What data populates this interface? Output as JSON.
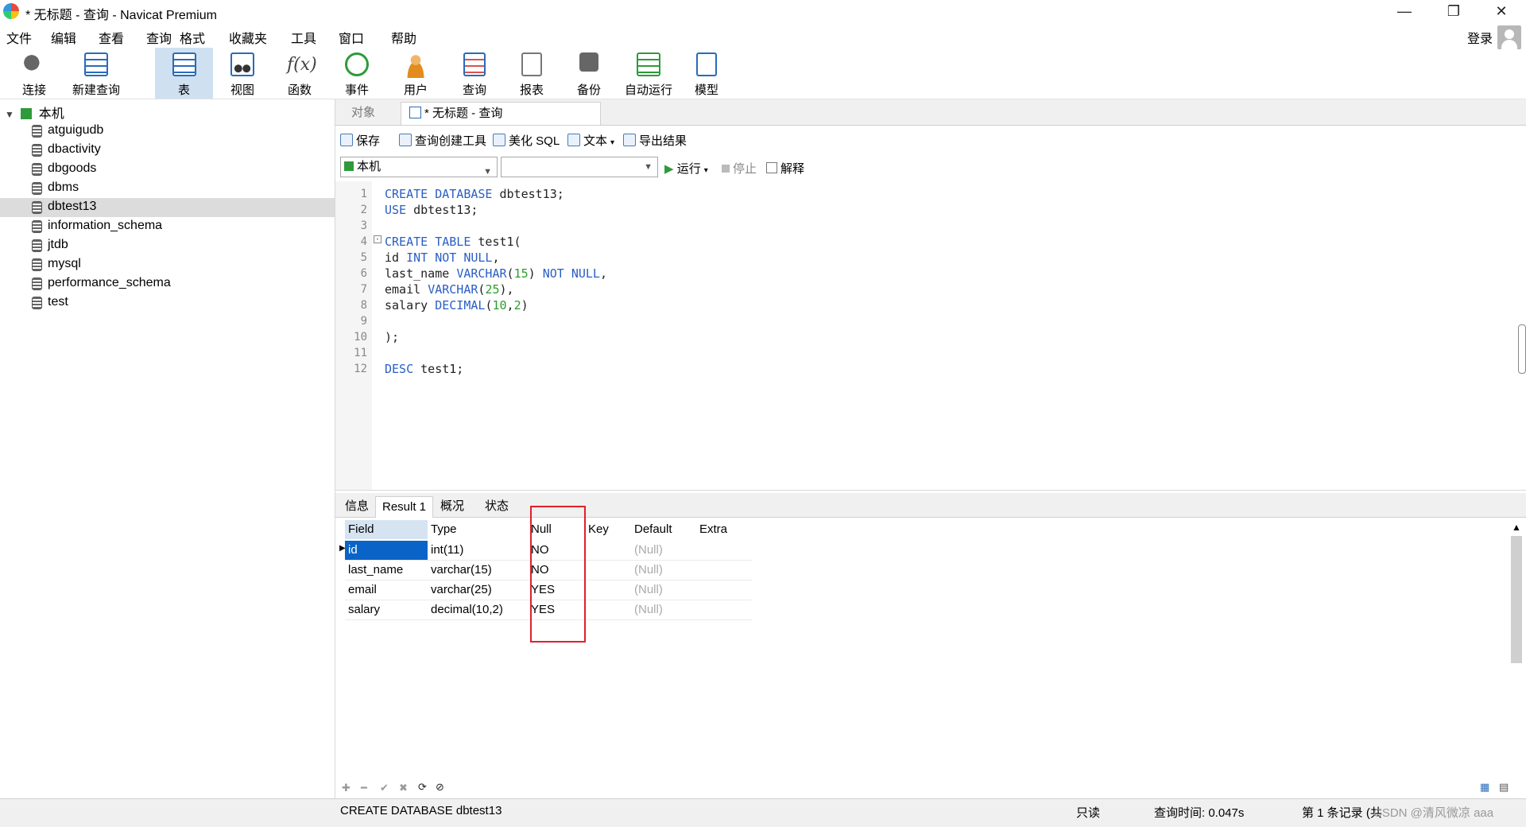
{
  "window": {
    "title": "* 无标题 - 查询 - Navicat Premium",
    "minimize": "—",
    "restore": "❐",
    "close": "✕"
  },
  "menu": [
    "文件",
    "编辑",
    "查看",
    "查询",
    "格式",
    "收藏夹",
    "工具",
    "窗口",
    "帮助"
  ],
  "login_label": "登录",
  "toolbar": [
    {
      "label": "连接",
      "icon": "connection-icon",
      "color": "#555555"
    },
    {
      "label": "新建查询",
      "icon": "new-query-icon",
      "color": "#2a6bb8"
    },
    {
      "label": "表",
      "icon": "table-icon",
      "color": "#2a6bb8"
    },
    {
      "label": "视图",
      "icon": "view-icon",
      "color": "#2a6bb8"
    },
    {
      "label": "函数",
      "icon": "function-icon",
      "color": "#444444"
    },
    {
      "label": "事件",
      "icon": "event-icon",
      "color": "#2f9a3a"
    },
    {
      "label": "用户",
      "icon": "user-icon",
      "color": "#e38b1c"
    },
    {
      "label": "查询",
      "icon": "query-icon",
      "color": "#2a6bb8"
    },
    {
      "label": "报表",
      "icon": "report-icon",
      "color": "#777777"
    },
    {
      "label": "备份",
      "icon": "backup-icon",
      "color": "#666666"
    },
    {
      "label": "自动运行",
      "icon": "auto-run-icon",
      "color": "#2f9a3a"
    },
    {
      "label": "模型",
      "icon": "model-icon",
      "color": "#2a6bb8"
    }
  ],
  "tree": {
    "root": "本机",
    "databases": [
      "atguigudb",
      "dbactivity",
      "dbgoods",
      "dbms",
      "dbtest13",
      "information_schema",
      "jtdb",
      "mysql",
      "performance_schema",
      "test"
    ],
    "selected": "dbtest13"
  },
  "tabs": {
    "objects": "对象",
    "query": "* 无标题 - 查询"
  },
  "query_toolbar": {
    "save": "保存",
    "builder": "查询创建工具",
    "beautify": "美化 SQL",
    "text": "文本",
    "export": "导出结果",
    "connection": "本机",
    "database": "",
    "run": "运行",
    "stop": "停止",
    "explain": "解释"
  },
  "editor": {
    "lines": [
      {
        "n": "1",
        "code": "CREATE DATABASE dbtest13;"
      },
      {
        "n": "2",
        "code": "USE dbtest13;"
      },
      {
        "n": "3",
        "code": ""
      },
      {
        "n": "4",
        "code": "CREATE TABLE test1("
      },
      {
        "n": "5",
        "code": "id INT NOT NULL,"
      },
      {
        "n": "6",
        "code": "last_name VARCHAR(15) NOT NULL,"
      },
      {
        "n": "7",
        "code": "email VARCHAR(25),"
      },
      {
        "n": "8",
        "code": "salary DECIMAL(10,2)"
      },
      {
        "n": "9",
        "code": ""
      },
      {
        "n": "10",
        "code": ");"
      },
      {
        "n": "11",
        "code": ""
      },
      {
        "n": "12",
        "code": "DESC test1;"
      }
    ]
  },
  "result_tabs": [
    "信息",
    "Result 1",
    "概况",
    "状态"
  ],
  "result": {
    "columns": [
      "Field",
      "Type",
      "Null",
      "Key",
      "Default",
      "Extra"
    ],
    "rows": [
      [
        "id",
        "int(11)",
        "NO",
        "",
        "(Null)",
        ""
      ],
      [
        "last_name",
        "varchar(15)",
        "NO",
        "",
        "(Null)",
        ""
      ],
      [
        "email",
        "varchar(25)",
        "YES",
        "",
        "(Null)",
        ""
      ],
      [
        "salary",
        "decimal(10,2)",
        "YES",
        "",
        "(Null)",
        ""
      ]
    ]
  },
  "statusbar": {
    "sql": "CREATE DATABASE dbtest13",
    "readonly": "只读",
    "query_time": "查询时间: 0.047s",
    "records": "第 1 条记录 (共",
    "watermark": "CSDN @清风微凉 aaa"
  }
}
